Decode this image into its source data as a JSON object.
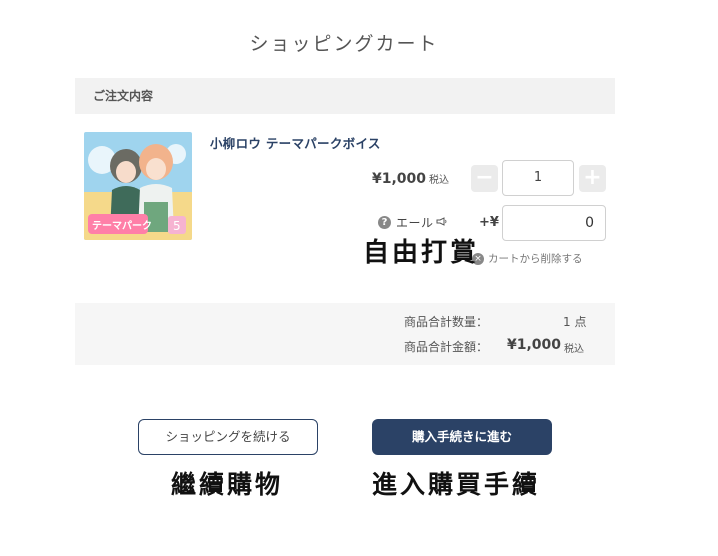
{
  "page": {
    "title": "ショッピングカート"
  },
  "order": {
    "section_title": "ご注文内容",
    "item": {
      "name": "小柳ロウ テーマパークボイス",
      "price": "¥1,000",
      "tax_label": "税込",
      "quantity": "1",
      "decrement_symbol": "−",
      "increment_symbol": "+",
      "yell_label": "エール",
      "yell_icon": "megaphone-icon",
      "yell_prefix": "+¥",
      "yell_amount": "0",
      "remove_label": "カートから削除する",
      "thumbnail_caption": "テーマパーク"
    }
  },
  "summary": {
    "count_label": "商品合計数量：",
    "count_value": "1 点",
    "total_label": "商品合計金額：",
    "total_value": "¥1,000",
    "total_tax": "税込"
  },
  "buttons": {
    "continue_label": "ショッピングを続ける",
    "checkout_label": "購入手続きに進む"
  },
  "annotations": {
    "tip": "自由打賞",
    "continue": "繼續購物",
    "checkout": "進入購買手續"
  },
  "colors": {
    "brand": "#2b4266",
    "header_bg": "#f2f2f2",
    "summary_bg": "#f6f6f6"
  }
}
